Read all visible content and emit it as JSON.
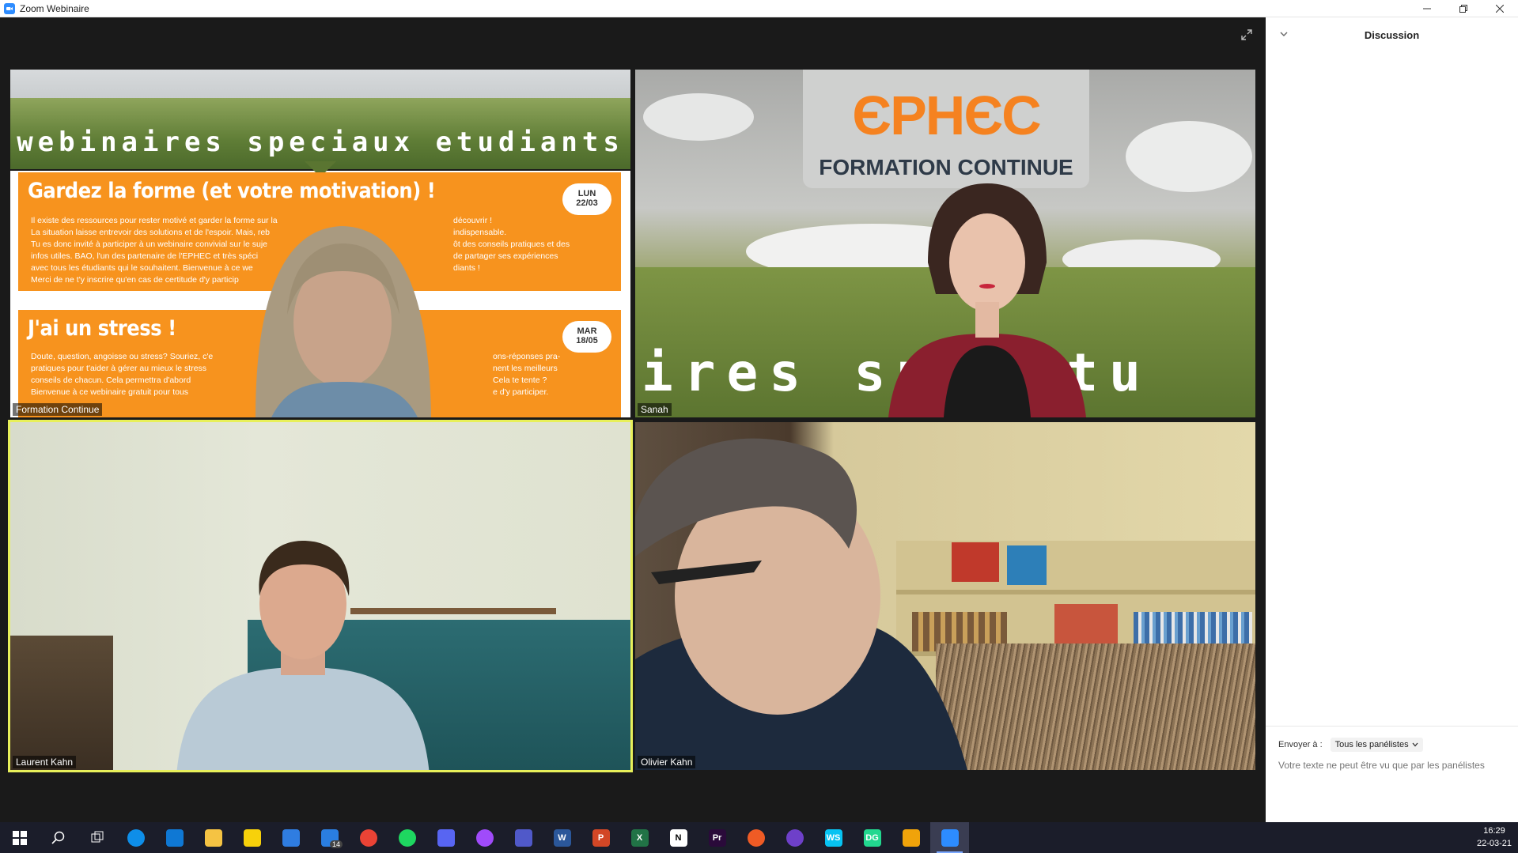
{
  "window": {
    "title": "Zoom Webinaire",
    "controls": [
      "minimize-icon",
      "restore-icon",
      "close-icon"
    ]
  },
  "tiles": [
    {
      "name": "Formation Continue",
      "banner_title": "webinaires speciaux etudiants",
      "card1": {
        "title": "Gardez la forme (et votre motivation) !",
        "date_day": "LUN",
        "date": "22/03",
        "body": [
          "Il existe des ressources pour rester motivé et garder la forme sur la",
          "La situation laisse entrevoir des solutions et de l'espoir. Mais, reb",
          "Tu es donc invité à participer à un webinaire convivial sur le suje",
          "infos utiles. BAO, l'un des partenaire de l'EPHEC et très spéci",
          "avec tous les étudiants qui le souhaitent.  Bienvenue à ce we",
          "Merci de ne t'y inscrire qu'en cas de certitude d'y particip"
        ],
        "body_right": [
          "découvrir !",
          "indispensable.",
          "ôt des conseils pratiques et des",
          "de partager ses expériences",
          "diants !"
        ]
      },
      "card2": {
        "title": "J'ai un stress !",
        "date_day": "MAR",
        "date": "18/05",
        "body": [
          "Doute, question, angoisse ou stress? Souriez, c'e",
          "pratiques pour t'aider à gérer au mieux le stress",
          "conseils de chacun. Cela permettra d'abord",
          "Bienvenue à ce webinaire gratuit pour tous"
        ],
        "body_right": [
          "ons-réponses pra-",
          "nent les meilleurs",
          "Cela te tente ?",
          "e d'y participer."
        ]
      }
    },
    {
      "name": "Sanah",
      "logo": "ЄPHЄC",
      "logo_sub": "FORMATION CONTINUE",
      "background_text": "ires spe      etu"
    },
    {
      "name": "Laurent Kahn",
      "active_speaker": true
    },
    {
      "name": "Olivier Kahn"
    }
  ],
  "chat": {
    "title": "Discussion",
    "send_to_label": "Envoyer à :",
    "recipient": "Tous les panélistes",
    "placeholder": "Votre texte ne peut être vu que par les panélistes"
  },
  "taskbar": {
    "items": [
      {
        "icon": "windows-start-icon",
        "color": "#ffffff"
      },
      {
        "icon": "search-icon",
        "color": "#ffffff"
      },
      {
        "icon": "task-view-icon",
        "color": "#ffffff"
      },
      {
        "icon": "teamviewer-icon",
        "color": "#0e8ee9"
      },
      {
        "icon": "onedrive-icon",
        "color": "#0f78d4"
      },
      {
        "icon": "file-explorer-icon",
        "color": "#f5c343"
      },
      {
        "icon": "sticky-notes-icon",
        "color": "#f7d10b"
      },
      {
        "icon": "todo-icon",
        "color": "#2f7de1"
      },
      {
        "icon": "mail-icon",
        "color": "#2a7ee0",
        "badge": "14"
      },
      {
        "icon": "chrome-icon",
        "color": "#ea4335"
      },
      {
        "icon": "spotify-icon",
        "color": "#1ed760"
      },
      {
        "icon": "discord-icon",
        "color": "#5865f2"
      },
      {
        "icon": "messenger-icon",
        "color": "#a04bfa"
      },
      {
        "icon": "teams-icon",
        "color": "#5059c9"
      },
      {
        "icon": "word-icon",
        "color": "#2b579a",
        "label": "W"
      },
      {
        "icon": "powerpoint-icon",
        "color": "#d24726",
        "label": "P"
      },
      {
        "icon": "excel-icon",
        "color": "#217346",
        "label": "X"
      },
      {
        "icon": "notion-icon",
        "color": "#ffffff",
        "label": "N"
      },
      {
        "icon": "premiere-icon",
        "color": "#2a0a3a",
        "label": "Pr"
      },
      {
        "icon": "postman-icon",
        "color": "#ef5b25"
      },
      {
        "icon": "github-icon",
        "color": "#6e40c9"
      },
      {
        "icon": "webstorm-icon",
        "color": "#07c3f2",
        "label": "WS"
      },
      {
        "icon": "datagrip-icon",
        "color": "#22d88f",
        "label": "DG"
      },
      {
        "icon": "remote-desktop-icon",
        "color": "#f0a30a"
      },
      {
        "icon": "zoom-icon",
        "color": "#2d8cff",
        "active": true
      }
    ],
    "time": "16:29",
    "date": "22-03-21"
  }
}
